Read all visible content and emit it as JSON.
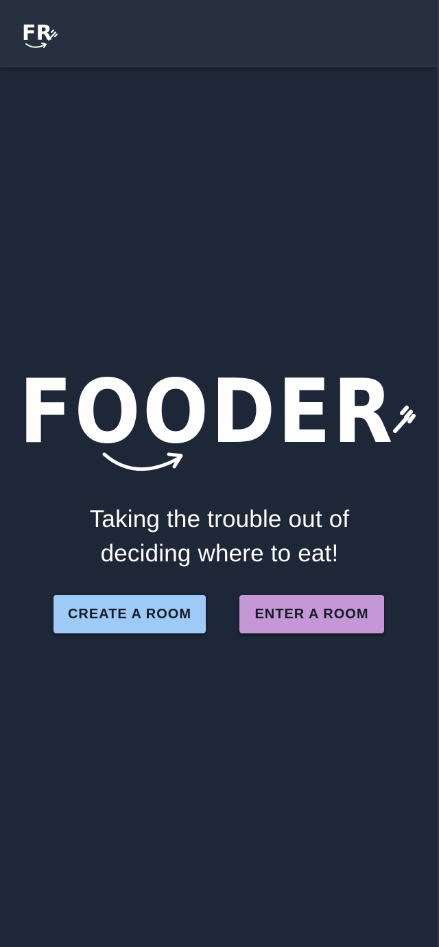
{
  "header": {
    "logo_text": "FR",
    "logo_icon": "fork-arrow-logo-icon"
  },
  "hero": {
    "logo_text": "FOODER",
    "logo_icon": "fork-arrow-logo-icon",
    "tagline": "Taking the trouble out of deciding where to eat!"
  },
  "actions": {
    "create_label": "CREATE A ROOM",
    "enter_label": "ENTER A ROOM"
  },
  "colors": {
    "background": "#1e2738",
    "header": "#252f3e",
    "create_button": "#9ecbf5",
    "enter_button": "#c597d6",
    "text": "#ffffff"
  }
}
